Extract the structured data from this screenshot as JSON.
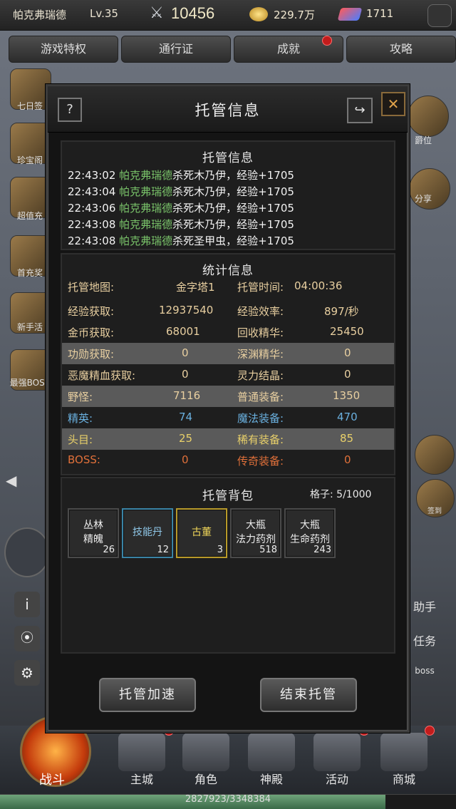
{
  "topbar": {
    "player_name": "帕克弗瑞德",
    "level": "Lv.35",
    "power": "10456",
    "gold": "229.7万",
    "gems": "1711"
  },
  "tabs": [
    "游戏特权",
    "通行证",
    "成就",
    "攻略"
  ],
  "left_icons": [
    "七日签",
    "珍宝阁",
    "超值充",
    "首充奖",
    "新手活",
    "最强BOSS"
  ],
  "right_icons": [
    "爵位",
    "分享",
    "签到",
    "助手",
    "任务",
    "boss"
  ],
  "dialog": {
    "title": "托管信息",
    "help_glyph": "?",
    "close_glyph": "✕",
    "share_glyph": "↪",
    "log_section_title": "托管信息",
    "log": [
      {
        "time": "22:43:02",
        "who": "帕克弗瑞德",
        "msg": "杀死木乃伊，经验+1705"
      },
      {
        "time": "22:43:04",
        "who": "帕克弗瑞德",
        "msg": "杀死木乃伊，经验+1705"
      },
      {
        "time": "22:43:06",
        "who": "帕克弗瑞德",
        "msg": "杀死木乃伊，经验+1705"
      },
      {
        "time": "22:43:08",
        "who": "帕克弗瑞德",
        "msg": "杀死木乃伊，经验+1705"
      },
      {
        "time": "22:43:08",
        "who": "帕克弗瑞德",
        "msg": "杀死圣甲虫，经验+1705"
      }
    ],
    "stats_section_title": "统计信息",
    "stats": [
      {
        "l1": "托管地图:",
        "v1": "金字塔1",
        "l2": "托管时间:",
        "v2": "04:00:36"
      },
      {
        "l1": "经验获取:",
        "v1": "12937540",
        "l2": "经验效率:",
        "v2": "897/秒"
      },
      {
        "l1": "金币获取:",
        "v1": "68001",
        "l2": "回收精华:",
        "v2": "25450"
      },
      {
        "l1": "功勋获取:",
        "v1": "0",
        "l2": "深渊精华:",
        "v2": "0"
      },
      {
        "l1": "恶魔精血获取:",
        "v1": "0",
        "l2": "灵力结晶:",
        "v2": "0"
      },
      {
        "l1": "野怪:",
        "v1": "7116",
        "l2": "普通装备:",
        "v2": "1350"
      },
      {
        "l1": "精英:",
        "v1": "74",
        "l2": "魔法装备:",
        "v2": "470"
      },
      {
        "l1": "头目:",
        "v1": "25",
        "l2": "稀有装备:",
        "v2": "85"
      },
      {
        "l1": "BOSS:",
        "v1": "0",
        "l2": "传奇装备:",
        "v2": "0"
      }
    ],
    "bag_section_title": "托管背包",
    "bag_capacity": "格子: 5/1000",
    "bag_items": [
      {
        "name": "丛林精魄",
        "count": "26"
      },
      {
        "name": "技能丹",
        "count": "12"
      },
      {
        "name": "古董",
        "count": "3"
      },
      {
        "name": "大瓶法力药剂",
        "count": "518"
      },
      {
        "name": "大瓶生命药剂",
        "count": "243"
      }
    ],
    "speedup_button": "托管加速",
    "end_button": "结束托管"
  },
  "nav": {
    "battle": "战斗",
    "items": [
      "主城",
      "角色",
      "神殿",
      "活动",
      "商城"
    ]
  },
  "xp": {
    "text": "2827923/3348384",
    "fraction": 0.845
  },
  "colors": {
    "green_name": "#7ac46a",
    "blue": "#6ab0df",
    "gold": "#e8d06a",
    "orange": "#e0703a",
    "label_gold": "#e8cfa0"
  }
}
